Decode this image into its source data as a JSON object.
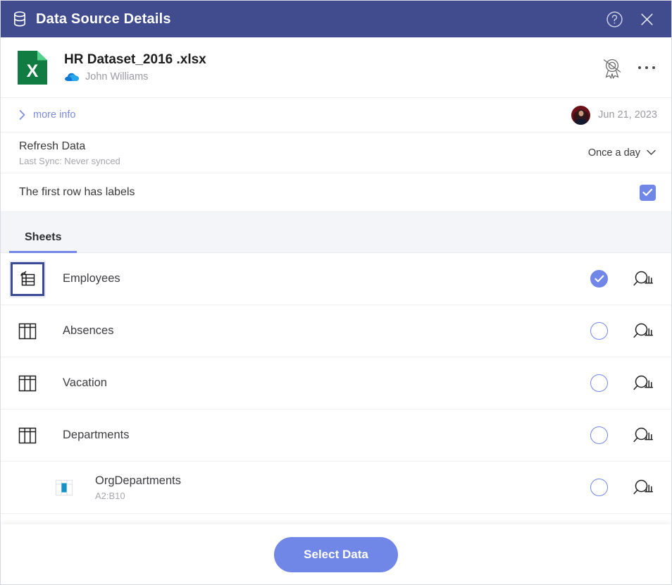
{
  "window": {
    "title": "Data Source Details",
    "title_icon": "database-icon",
    "help_icon": "help-circle-icon",
    "close_icon": "close-icon",
    "header_color": "#414C8E"
  },
  "file": {
    "icon": "excel-file-icon",
    "name": "HR Dataset_2016 .xlsx",
    "source_icon": "onedrive-cloud-icon",
    "owner": "John Williams",
    "certify_icon": "not-certified-badge-icon",
    "menu_icon": "kebab-menu-icon"
  },
  "info": {
    "more_info_label": "more info",
    "chevron_icon": "chevron-right-icon",
    "avatar_icon": "user-avatar",
    "date": "Jun 21, 2023"
  },
  "refresh": {
    "title": "Refresh Data",
    "subtitle": "Last Sync: Never synced",
    "frequency": "Once a day",
    "chevron_icon": "chevron-down-icon"
  },
  "labels": {
    "text": "The first row has labels",
    "checked": true,
    "check_icon": "checkmark-icon",
    "accent": "#7187e8"
  },
  "tabs": [
    {
      "label": "Sheets",
      "active": true
    }
  ],
  "sheets": [
    {
      "name": "Employees",
      "range": "",
      "icon": "table-refresh-icon",
      "selected": true,
      "focused": true,
      "nested": false,
      "preview_icon": "preview-data-icon"
    },
    {
      "name": "Absences",
      "range": "",
      "icon": "table-icon",
      "selected": false,
      "focused": false,
      "nested": false,
      "preview_icon": "preview-data-icon"
    },
    {
      "name": "Vacation",
      "range": "",
      "icon": "table-icon",
      "selected": false,
      "focused": false,
      "nested": false,
      "preview_icon": "preview-data-icon"
    },
    {
      "name": "Departments",
      "range": "",
      "icon": "table-icon",
      "selected": false,
      "focused": false,
      "nested": false,
      "preview_icon": "preview-data-icon"
    },
    {
      "name": "OrgDepartments",
      "range": "A2:B10",
      "icon": "named-range-icon",
      "selected": false,
      "focused": false,
      "nested": true,
      "preview_icon": "preview-data-icon"
    }
  ],
  "footer": {
    "primary_button": "Select Data",
    "primary_color": "#7187e8"
  }
}
